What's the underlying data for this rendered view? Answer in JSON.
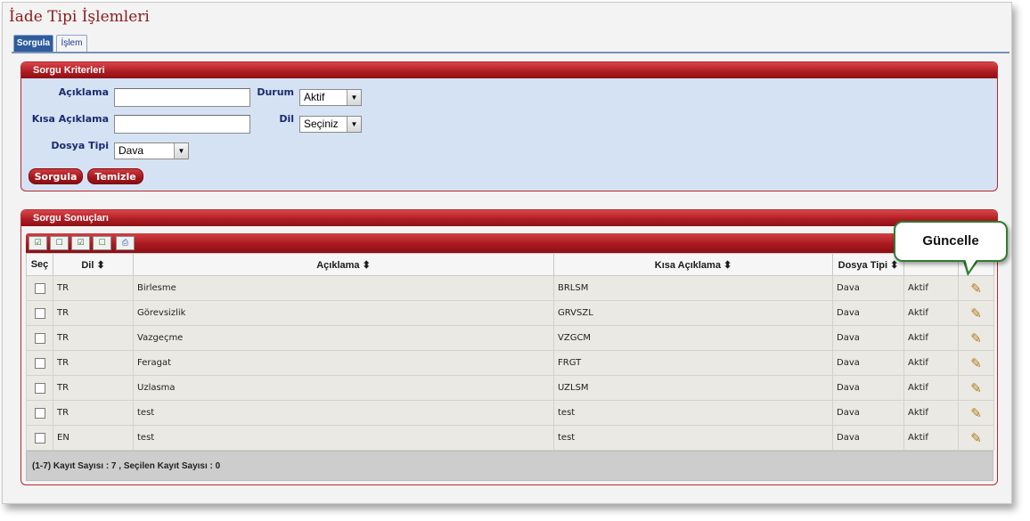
{
  "page": {
    "title": "İade Tipi İşlemleri"
  },
  "tabs": [
    {
      "label": "Sorgula",
      "active": true
    },
    {
      "label": "İşlem",
      "active": false
    }
  ],
  "criteria": {
    "title": "Sorgu Kriterleri",
    "aciklama_label": "Açıklama",
    "aciklama_value": "",
    "kisa_aciklama_label": "Kısa Açıklama",
    "kisa_aciklama_value": "",
    "dosya_tipi_label": "Dosya Tipi",
    "dosya_tipi_value": "Dava",
    "durum_label": "Durum",
    "durum_value": "Aktif",
    "dil_label": "Dil",
    "dil_value": "Seçiniz",
    "sorgula_button": "Sorgula",
    "temizle_button": "Temizle"
  },
  "results": {
    "title": "Sorgu Sonuçları",
    "columns": [
      "Seç",
      "Dil",
      "Açıklama",
      "Kısa Açıklama",
      "Dosya Tipi",
      "",
      ""
    ],
    "rows": [
      {
        "dil": "TR",
        "aciklama": "Birlesme",
        "kisa": "BRLSM",
        "dosya_tipi": "Dava",
        "durum": "Aktif"
      },
      {
        "dil": "TR",
        "aciklama": "Görevsizlik",
        "kisa": "GRVSZL",
        "dosya_tipi": "Dava",
        "durum": "Aktif"
      },
      {
        "dil": "TR",
        "aciklama": "Vazgeçme",
        "kisa": "VZGCM",
        "dosya_tipi": "Dava",
        "durum": "Aktif"
      },
      {
        "dil": "TR",
        "aciklama": "Feragat",
        "kisa": "FRGT",
        "dosya_tipi": "Dava",
        "durum": "Aktif"
      },
      {
        "dil": "TR",
        "aciklama": "Uzlasma",
        "kisa": "UZLSM",
        "dosya_tipi": "Dava",
        "durum": "Aktif"
      },
      {
        "dil": "TR",
        "aciklama": "test",
        "kisa": "test",
        "dosya_tipi": "Dava",
        "durum": "Aktif"
      },
      {
        "dil": "EN",
        "aciklama": "test",
        "kisa": "test",
        "dosya_tipi": "Dava",
        "durum": "Aktif"
      }
    ],
    "footer": "(1-7) Kayıt Sayısı : 7   , Seçilen Kayıt Sayısı : 0"
  },
  "toolbar_icons": [
    "select-all-icon",
    "deselect-all-icon",
    "select-page-icon",
    "clear-selection-icon",
    "export-icon"
  ],
  "callout": {
    "text": "Güncelle"
  },
  "colors": {
    "accent": "#b01d22",
    "panel_bg": "#d4e2f4",
    "label": "#1c2a6e",
    "callout_border": "#2e7d32"
  }
}
